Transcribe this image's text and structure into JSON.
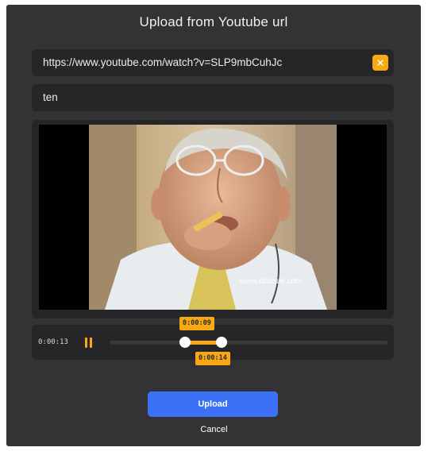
{
  "dialog": {
    "title": "Upload from Youtube url",
    "url_value": "https://www.youtube.com/watch?v=SLP9mbCuhJc",
    "name_value": "ten"
  },
  "video": {
    "watermark": "www.dracule.com"
  },
  "player": {
    "current_time": "0:00:13",
    "trim_start": "0:00:09",
    "trim_end": "0:00:14"
  },
  "actions": {
    "upload_label": "Upload",
    "cancel_label": "Cancel"
  },
  "colors": {
    "accent": "#f7a812",
    "primary": "#3b71f6",
    "dialog_bg": "#333335",
    "field_bg": "#262628"
  }
}
